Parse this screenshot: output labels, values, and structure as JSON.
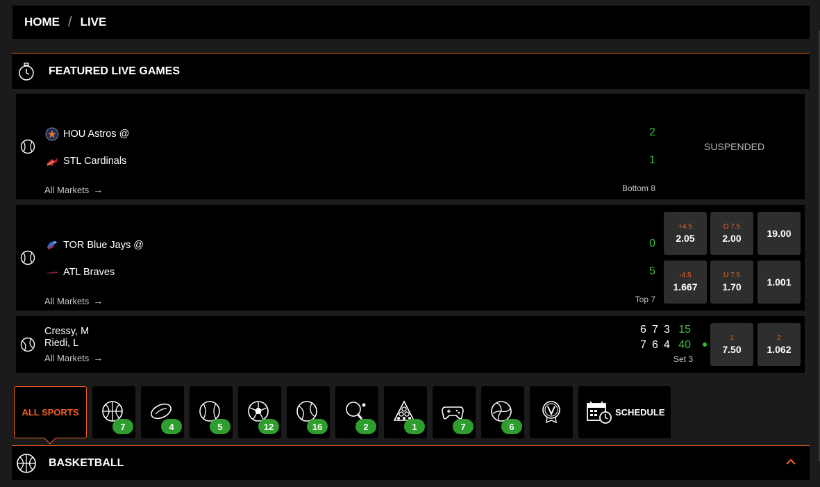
{
  "breadcrumb": {
    "home": "HOME",
    "separator": "/",
    "current": "LIVE"
  },
  "featured": {
    "title": "FEATURED LIVE GAMES",
    "icon": "stopwatch-icon"
  },
  "games": [
    {
      "sport_icon": "baseball-icon",
      "team1": "HOU Astros @",
      "team2": "STL Cardinals",
      "score1": "2",
      "score2": "1",
      "period": "Bottom 8",
      "status": "SUSPENDED",
      "all_markets": "All Markets"
    },
    {
      "sport_icon": "baseball-icon",
      "team1": "TOR Blue Jays @",
      "team2": "ATL Braves",
      "score1": "0",
      "score2": "5",
      "period": "Top 7",
      "all_markets": "All Markets",
      "odds": [
        {
          "label": "+4.5",
          "value": "2.05"
        },
        {
          "label": "O 7.5",
          "value": "2.00"
        },
        {
          "label": "",
          "value": "19.00"
        },
        {
          "label": "-4.5",
          "value": "1.667"
        },
        {
          "label": "U 7.5",
          "value": "1.70"
        },
        {
          "label": "",
          "value": "1.001"
        }
      ]
    },
    {
      "sport_icon": "tennis-ball-icon",
      "player1": "Cressy, M",
      "player2": "Riedi, L",
      "sets1": [
        "6",
        "7",
        "3"
      ],
      "sets2": [
        "7",
        "6",
        "4"
      ],
      "points1": "15",
      "points2": "40",
      "period": "Set 3",
      "all_markets": "All Markets",
      "odds": [
        {
          "label": "1",
          "value": "7.50"
        },
        {
          "label": "2",
          "value": "1.062"
        }
      ]
    }
  ],
  "sports_nav": {
    "all_sports": "ALL SPORTS",
    "tiles": [
      {
        "icon": "basketball-icon",
        "count": "7"
      },
      {
        "icon": "football-icon",
        "count": "4"
      },
      {
        "icon": "baseball-icon",
        "count": "5"
      },
      {
        "icon": "soccer-ball-icon",
        "count": "12"
      },
      {
        "icon": "tennis-ball-icon",
        "count": "16"
      },
      {
        "icon": "table-tennis-icon",
        "count": "2"
      },
      {
        "icon": "billiards-icon",
        "count": "1"
      },
      {
        "icon": "gamepad-icon",
        "count": "7"
      },
      {
        "icon": "volleyball-icon",
        "count": "6"
      },
      {
        "icon": "v-badge-icon",
        "count": ""
      }
    ],
    "schedule": "SCHEDULE"
  },
  "section": {
    "title": "BASKETBALL",
    "icon": "basketball-icon"
  },
  "colors": {
    "accent": "#f26322",
    "score_green": "#3dbb3d",
    "badge_green": "#2e9e2e",
    "tile_bg": "#2e2e2e"
  }
}
